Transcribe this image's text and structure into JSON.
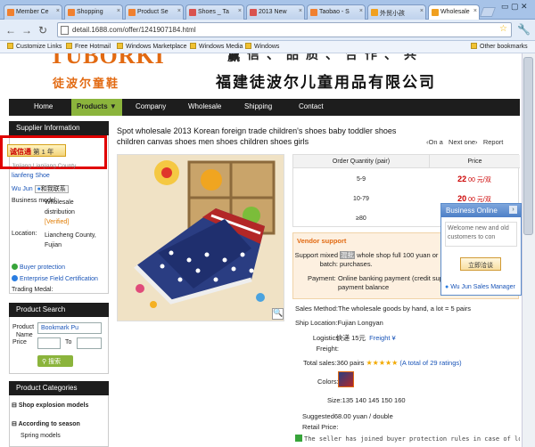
{
  "browser": {
    "tabs": [
      {
        "label": "Member Ce",
        "active": false
      },
      {
        "label": "Shopping",
        "active": false
      },
      {
        "label": "Product Se",
        "active": false
      },
      {
        "label": "Shoes _ Ta",
        "active": false
      },
      {
        "label": "2013 New",
        "active": false
      },
      {
        "label": "Taobao - S",
        "active": false
      },
      {
        "label": "外贸小孩",
        "active": false
      },
      {
        "label": "Wholesale",
        "active": true
      }
    ],
    "url": "detail.1688.com/offer/1241907184.html",
    "bookmarks": [
      "Customize Links",
      "Free Hotmail",
      "Windows Marketplace",
      "Windows Media",
      "Windows"
    ],
    "other_bookmarks": "Other bookmarks"
  },
  "banner": {
    "logo_text": "TUBORKIDS",
    "logo_cn": "徒波尔童鞋",
    "slogan_partial": "诚信、品质、合作、共赢",
    "company_name": "福建徒波尔儿童用品有限公司"
  },
  "nav": {
    "items": [
      "Home",
      "Products ▼",
      "Company",
      "Wholesale",
      "Shipping",
      "Contact"
    ],
    "active": "Products ▼"
  },
  "supplier": {
    "header": "Supplier Information",
    "badge_brand": "诚信通",
    "badge_years": "第 1 年",
    "company_partial": "Jinjiang Lianjiang County",
    "company_name": "lianfeng Shoe",
    "contact": "Wu Jun",
    "contact_action": "和我联系",
    "business_model_label": "Business model:",
    "business_model_value": "Wholesale distribution",
    "verified": "[Verified]",
    "location_label": "Location:",
    "location_value": "Liancheng County, Fujian",
    "buyer_protection": "Buyer protection",
    "enterprise_cert": "Enterprise Field Certification",
    "trading_medal": "Trading Medal:"
  },
  "product_search": {
    "header": "Product Search",
    "product_label": "Product",
    "product_value": "Bookmark Pu",
    "name_label": "Name",
    "price_label": "Price",
    "to_label": "To",
    "search_button": "搜索"
  },
  "categories": {
    "header": "Product Categories",
    "items": [
      "Shop explosion models",
      "According to season",
      "Spring models"
    ]
  },
  "product": {
    "title": "Spot wholesale 2013 Korean foreign trade children's shoes baby toddler shoes children canvas shoes men shoes children shoes girls",
    "prev": "‹On a",
    "next": "Next one›",
    "report": "Report",
    "zoom_icon": "magnifier-icon"
  },
  "pricing": {
    "col_qty": "Order Quantity (pair)",
    "col_price": "Price",
    "rows": [
      {
        "qty": "5-9",
        "price": "22",
        "unit": "00 元/双"
      },
      {
        "qty": "10-79",
        "price": "20",
        "unit": "00 元/双"
      },
      {
        "qty": "≥80",
        "price": "",
        "unit": ""
      }
    ]
  },
  "vendor": {
    "header": "Vendor support",
    "support_label": "Support mixed batch:",
    "support_icon": "混批",
    "support_value": "whole shop full 100 yuan or batch purchases.",
    "payment_label": "Payment:",
    "payment_value": "Online banking payment (credit supp Alipay payment balance"
  },
  "details": {
    "sales_method": "Sales Method:The wholesale goods by hand, a lot = 5 pairs",
    "ship_location": "Ship Location:Fujian Longyan",
    "logistics_label": "Logistics Freight:",
    "logistics_value": "快递 15元",
    "freight_link": "Freight",
    "total_sales": "Total sales:360 pairs",
    "ratings": "(A total of 29 ratings)",
    "colors_label": "Colors:",
    "sizes": "Size:135 140 145 150 160",
    "suggested": "Suggested68.00 yuan / double",
    "retail_label": "Retail Price:",
    "footer_note": "The seller has joined buyer protection rules in case of loss can"
  },
  "business_online": {
    "header": "Business Online",
    "message": "Welcome new and old customers to con",
    "button": "立即洽谈",
    "manager": "Wu Jun Sales Manager"
  }
}
